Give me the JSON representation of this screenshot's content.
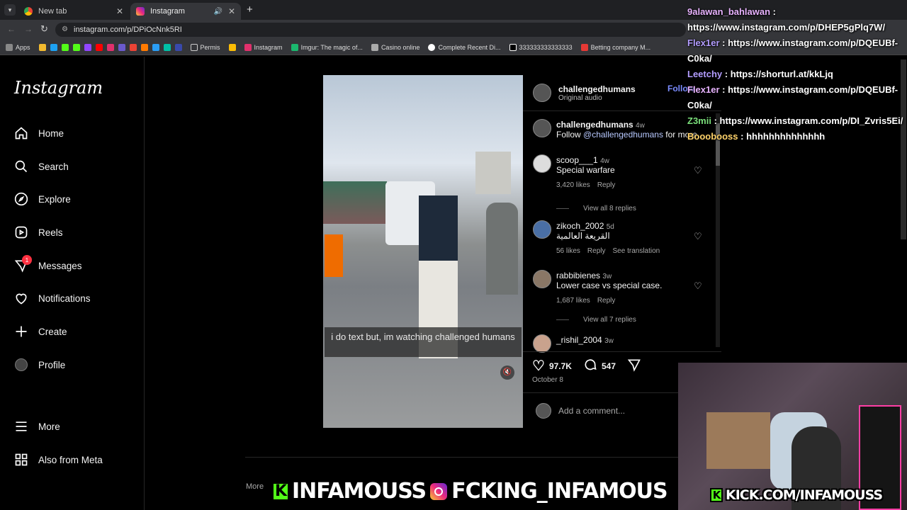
{
  "browser": {
    "tabs": [
      {
        "title": "New tab"
      },
      {
        "title": "Instagram"
      }
    ],
    "url": "instagram.com/p/DPiOcNnk5RI",
    "bookmarks": [
      "Apps",
      "Permis",
      "Instagram",
      "Imgur: The magic of...",
      "Casino online",
      "Complete Recent Di...",
      "333333333333333",
      "Betting company M..."
    ]
  },
  "sidebar": {
    "logo": "Instagram",
    "items": [
      {
        "label": "Home",
        "icon": "home-icon"
      },
      {
        "label": "Search",
        "icon": "search-icon"
      },
      {
        "label": "Explore",
        "icon": "compass-icon"
      },
      {
        "label": "Reels",
        "icon": "reels-icon"
      },
      {
        "label": "Messages",
        "icon": "messenger-icon"
      },
      {
        "label": "Notifications",
        "icon": "heart-icon"
      },
      {
        "label": "Create",
        "icon": "plus-icon"
      },
      {
        "label": "Profile",
        "icon": "avatar-icon"
      },
      {
        "label": "More",
        "icon": "menu-icon"
      },
      {
        "label": "Also from Meta",
        "icon": "meta-grid-icon"
      }
    ],
    "messages_badge": "1"
  },
  "post": {
    "author": "challengedhumans",
    "audio": "Original audio",
    "follow": "Follow",
    "video_caption": "i do text but, im watching challenged humans",
    "caption_author": "challengedhumans",
    "caption_age": "4w",
    "caption_text_prefix": "Follow ",
    "caption_mention": "@challengedhumans",
    "caption_text_suffix": " for more",
    "comments": [
      {
        "user": "scoop___1",
        "age": "4w",
        "text": "Special warfare",
        "likes": "3,420 likes",
        "reply": "Reply",
        "view_replies": "View all 8 replies"
      },
      {
        "user": "zikoch_2002",
        "age": "5d",
        "text": "القريعة العالمية",
        "likes": "56 likes",
        "reply": "Reply",
        "translate": "See translation"
      },
      {
        "user": "rabbibienes",
        "age": "3w",
        "text": "Lower case vs special case.",
        "likes": "1,687 likes",
        "reply": "Reply",
        "view_replies": "View all 7 replies"
      },
      {
        "user": "_rishil_2004",
        "age": "3w"
      }
    ],
    "like_count": "97.7K",
    "comment_count": "547",
    "date": "October 8",
    "add_comment_placeholder": "Add a comment..."
  },
  "more_label": "More",
  "chat": [
    {
      "user": "9alawan_bahlawan",
      "msg": "https://www.instagram.com/p/DHEP5gPlq7W/"
    },
    {
      "user": "Flex1er",
      "msg": "https://www.instagram.com/p/DQEUBf-C0ka/"
    },
    {
      "user": "Leetchy",
      "msg": "https://shorturl.at/kkLjq"
    },
    {
      "user": "Flex1er",
      "msg": "https://www.instagram.com/p/DQEUBf-C0ka/"
    },
    {
      "user": "Z3mii",
      "msg": "https://www.instagram.com/p/DI_Zvris5Ei/"
    },
    {
      "user": "Booobooss",
      "msg": "hhhhhhhhhhhhhh"
    }
  ],
  "banner": {
    "kick_handle": "INFAMOUSS",
    "ig_handle": "FCKING_INFAMOUS",
    "kick_url": "KICK.COM/INFAMOUSS"
  },
  "colors": {
    "kick_green": "#53fc18",
    "ig_link": "#e0f1ff",
    "follow_blue": "#0095f6",
    "badge_red": "#ff3040"
  }
}
